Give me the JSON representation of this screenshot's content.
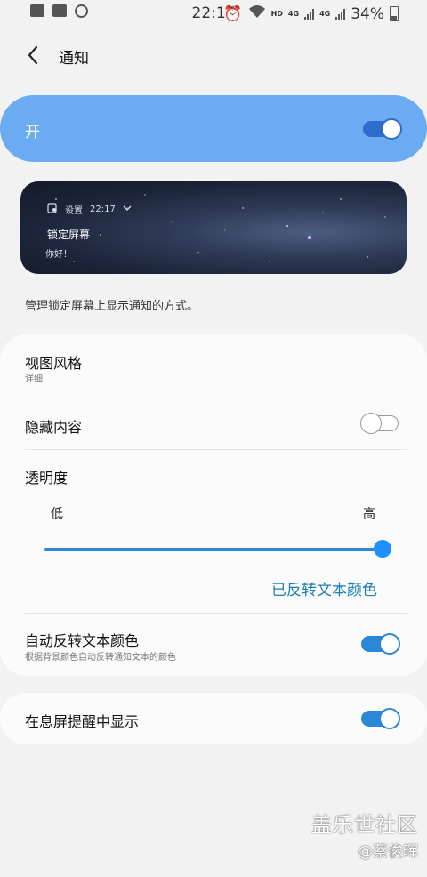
{
  "status_bar": {
    "time": "22:17",
    "hd": "HD",
    "net1": "4G",
    "net2": "4G",
    "battery": "34%"
  },
  "header": {
    "back_icon": "chevron-left-icon",
    "title": "通知"
  },
  "master": {
    "label": "开",
    "enabled": true
  },
  "preview": {
    "app_name": "设置",
    "time": "22:17",
    "title": "锁定屏幕",
    "body": "你好！"
  },
  "description": "管理锁定屏幕上显示通知的方式。",
  "settings": {
    "view_style": {
      "title": "视图风格",
      "value": "详细"
    },
    "hide_content": {
      "title": "隐藏内容",
      "enabled": false
    },
    "transparency": {
      "title": "透明度",
      "low": "低",
      "high": "高",
      "level": 1.0
    },
    "inverted_text": "已反转文本颜色",
    "auto_invert": {
      "title": "自动反转文本颜色",
      "subtitle": "根据背景颜色自动反转通知文本的颜色",
      "enabled": true
    },
    "aod": {
      "title": "在息屏提醒中显示",
      "enabled": true
    }
  },
  "watermark": {
    "line1": "盖乐世社区",
    "line2": "@蔡俊晖"
  },
  "colors": {
    "accent": "#2b88d8",
    "master_bg": "#6aabf2",
    "link": "#1b7fb5"
  }
}
